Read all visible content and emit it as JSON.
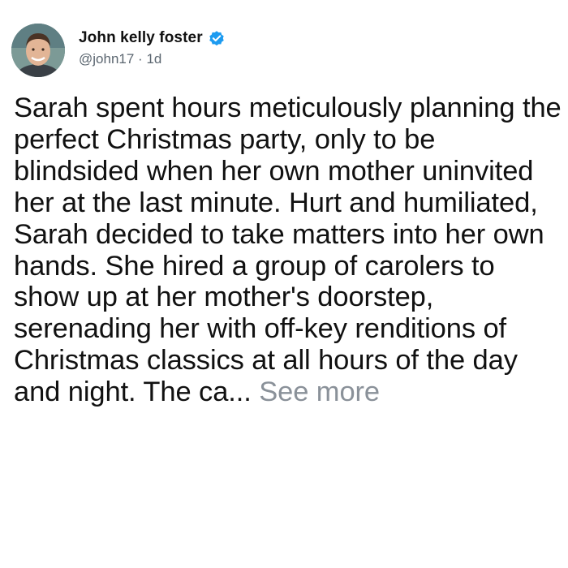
{
  "tweet": {
    "author": {
      "display_name": "John kelly foster",
      "handle": "@john17",
      "separator": "·",
      "age": "1d",
      "verified": true,
      "avatar_icon": "profile-photo",
      "verified_icon": "verified-badge-icon"
    },
    "body": "Sarah spent hours meticulously planning the perfect Christmas party, only to be blindsided when her own mother uninvited her at the last minute. Hurt and humiliated, Sarah decided to take matters into her own hands. She hired a group of carolers to show up at her mother's doorstep, serenading her with off-key renditions of Christmas classics at all hours of the day and night. The ca...",
    "see_more_label": "See more",
    "colors": {
      "text": "#111111",
      "muted": "#5b6670",
      "verified_blue": "#1d9bf0",
      "see_more": "#8a9199"
    }
  }
}
